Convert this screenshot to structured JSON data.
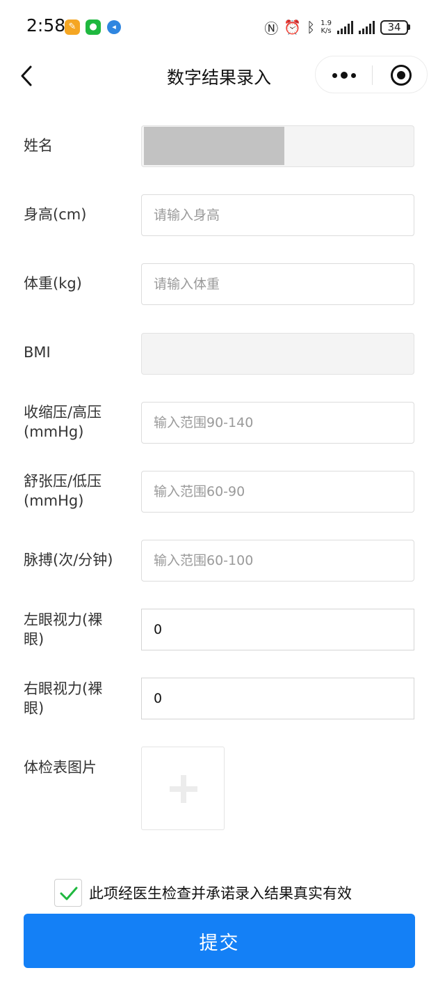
{
  "status_bar": {
    "time": "2:58",
    "net_speed_value": "1.9",
    "net_speed_unit": "K/s",
    "battery": "34",
    "icons": [
      "app-orange-icon",
      "wechat-icon",
      "browser-icon",
      "nfc-icon",
      "alarm-icon",
      "bluetooth-icon",
      "signal-icon",
      "battery-icon"
    ]
  },
  "nav": {
    "title": "数字结果录入"
  },
  "form": {
    "name": {
      "label": "姓名",
      "value": ""
    },
    "height": {
      "label": "身高(cm)",
      "placeholder": "请输入身高",
      "value": ""
    },
    "weight": {
      "label": "体重(kg)",
      "placeholder": "请输入体重",
      "value": ""
    },
    "bmi": {
      "label": "BMI",
      "value": ""
    },
    "systolic": {
      "label_line1": "收缩压/高压",
      "label_line2": "(mmHg)",
      "placeholder": "输入范围90-140",
      "value": ""
    },
    "diastolic": {
      "label_line1": "舒张压/低压",
      "label_line2": "(mmHg)",
      "placeholder": "输入范围60-90",
      "value": ""
    },
    "pulse": {
      "label": "脉搏(次/分钟)",
      "placeholder": "输入范围60-100",
      "value": ""
    },
    "left_eye": {
      "label_line1": "左眼视力(裸",
      "label_line2": "眼)",
      "value": "0"
    },
    "right_eye": {
      "label_line1": "右眼视力(裸",
      "label_line2": "眼)",
      "value": "0"
    },
    "photo": {
      "label": "体检表图片"
    }
  },
  "agreement": {
    "text": "此项经医生检查并承诺录入结果真实有效",
    "checked": true
  },
  "submit_label": "提交",
  "colors": {
    "primary": "#1480f6",
    "check": "#1fb83f"
  }
}
